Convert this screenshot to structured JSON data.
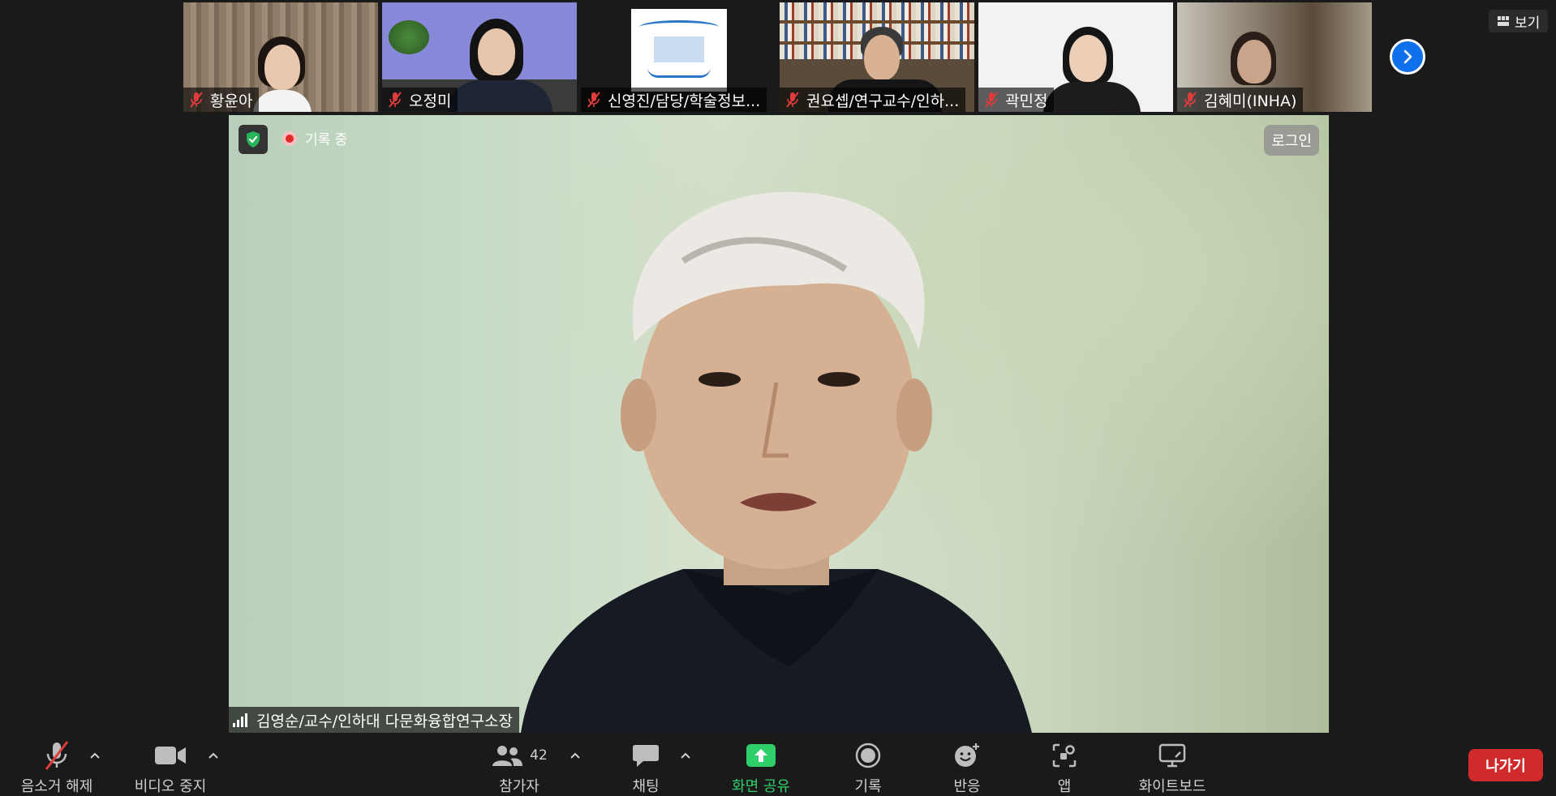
{
  "participants": [
    {
      "name": "황윤아"
    },
    {
      "name": "오정미"
    },
    {
      "name": "신영진/담당/학술정보..."
    },
    {
      "name": "권요셉/연구교수/인하..."
    },
    {
      "name": "곽민정"
    },
    {
      "name": "김혜미(INHA)"
    }
  ],
  "top_right": {
    "view_label": "보기"
  },
  "main": {
    "recording_label": "기록 중",
    "login_label": "로그인",
    "speaker_name": "김영순/교수/인하대 다문화융합연구소장"
  },
  "toolbar": {
    "unmute_label": "음소거 해제",
    "stop_video_label": "비디오 중지",
    "participants_label": "참가자",
    "participants_count": "42",
    "chat_label": "채팅",
    "share_label": "화면 공유",
    "record_label": "기록",
    "reactions_label": "반응",
    "apps_label": "앱",
    "whiteboard_label": "화이트보드",
    "leave_label": "나가기"
  },
  "colors": {
    "leave": "#d02a2a",
    "share": "#2fcf6a",
    "next_arrow": "#0e71eb",
    "muted_mic": "#e03c3c"
  }
}
